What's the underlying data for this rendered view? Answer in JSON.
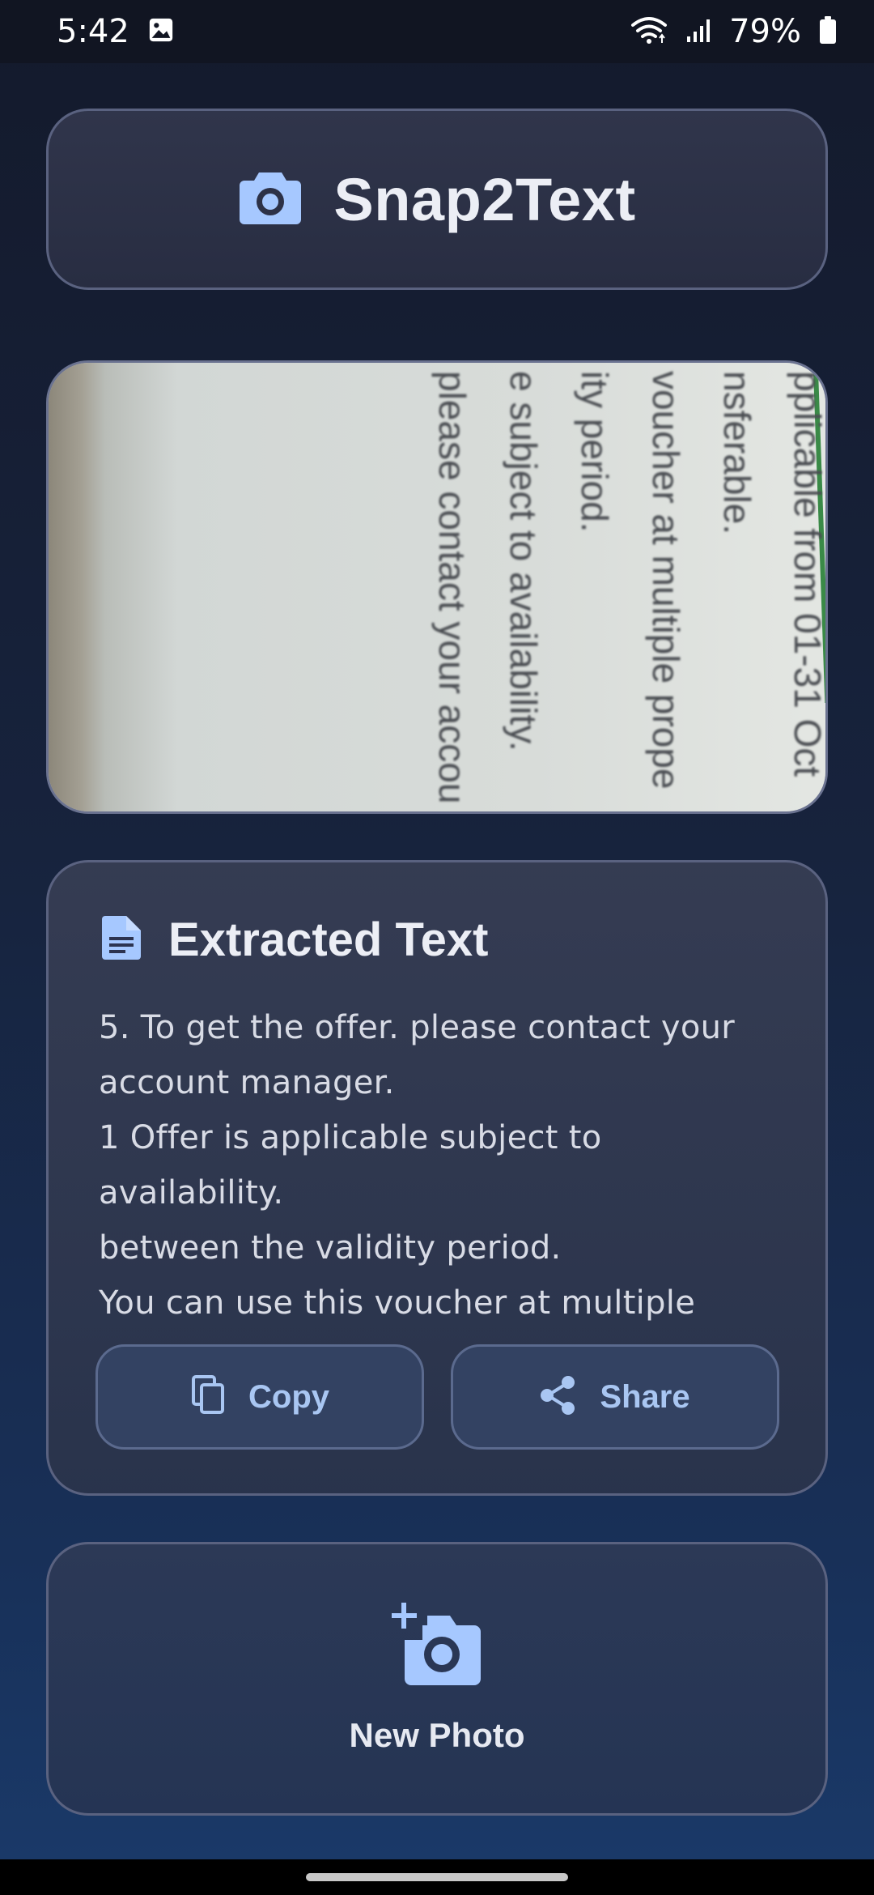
{
  "status_bar": {
    "time": "5:42",
    "battery": "79%"
  },
  "header": {
    "title": "Snap2Text"
  },
  "photo": {
    "lines": [
      "pplicable from 01-31 Oct",
      "nsferable.",
      "voucher at multiple prope",
      "ity period.",
      "e subject to availability.",
      "please contact your accou"
    ]
  },
  "extracted": {
    "title": "Extracted Text",
    "text": "5. To get the offer. please contact your account manager.\n1 Offer is applicable subject to availability.\nbetween the validity period.\nYou can use this voucher at multiple",
    "copy_label": "Copy",
    "share_label": "Share"
  },
  "new_photo": {
    "label": "New Photo"
  },
  "colors": {
    "accent": "#a9c6f2",
    "icon": "#a6c8ff",
    "background": "#17233d"
  }
}
